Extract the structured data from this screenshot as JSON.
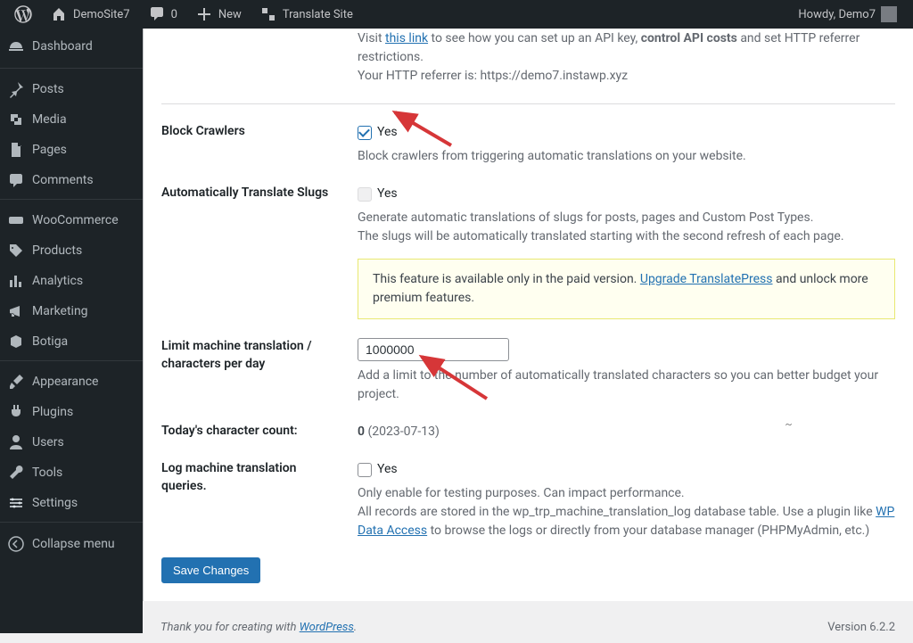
{
  "adminbar": {
    "site_name": "DemoSite7",
    "comments_count": "0",
    "new_label": "New",
    "translate_label": "Translate Site",
    "greeting": "Howdy, Demo7"
  },
  "sidebar": {
    "dashboard": "Dashboard",
    "posts": "Posts",
    "media": "Media",
    "pages": "Pages",
    "comments": "Comments",
    "woocommerce": "WooCommerce",
    "products": "Products",
    "analytics": "Analytics",
    "marketing": "Marketing",
    "botiga": "Botiga",
    "appearance": "Appearance",
    "plugins": "Plugins",
    "users": "Users",
    "tools": "Tools",
    "settings": "Settings",
    "collapse": "Collapse menu"
  },
  "cutoff": {
    "visit_prefix": "Visit ",
    "visit_link": "this link",
    "visit_mid": " to see how you can set up an API key, ",
    "visit_bold": "control API costs",
    "visit_rest": " and set HTTP referrer restrictions.",
    "referrer_line": "Your HTTP referrer is: https://demo7.instawp.xyz"
  },
  "rows": {
    "block_crawlers": {
      "label": "Block Crawlers",
      "yes": "Yes",
      "desc": "Block crawlers from triggering automatic translations on your website."
    },
    "auto_slugs": {
      "label": "Automatically Translate Slugs",
      "yes": "Yes",
      "desc1": "Generate automatic translations of slugs for posts, pages and Custom Post Types.",
      "desc2": "The slugs will be automatically translated starting with the second refresh of each page.",
      "notice_pre": "This feature is available only in the paid version. ",
      "notice_link": "Upgrade TranslatePress",
      "notice_post": " and unlock more premium features."
    },
    "limit": {
      "label": "Limit machine translation / characters per day",
      "value": "1000000",
      "desc": "Add a limit to the number of automatically translated characters so you can better budget your project."
    },
    "count": {
      "label": "Today's character count:",
      "value": "0",
      "date": " (2023-07-13)"
    },
    "log": {
      "label": "Log machine translation queries.",
      "yes": "Yes",
      "desc1": "Only enable for testing purposes. Can impact performance.",
      "desc2a": "All records are stored in the wp_trp_machine_translation_log database table. Use a plugin like ",
      "desc2_link": "WP Data Access",
      "desc2b": " to browse the logs or directly from your database manager (PHPMyAdmin, etc.)"
    }
  },
  "submit": {
    "save": "Save Changes"
  },
  "footer": {
    "thanks_pre": "Thank you for creating with ",
    "thanks_link": "WordPress",
    "thanks_post": ".",
    "version": "Version 6.2.2"
  }
}
